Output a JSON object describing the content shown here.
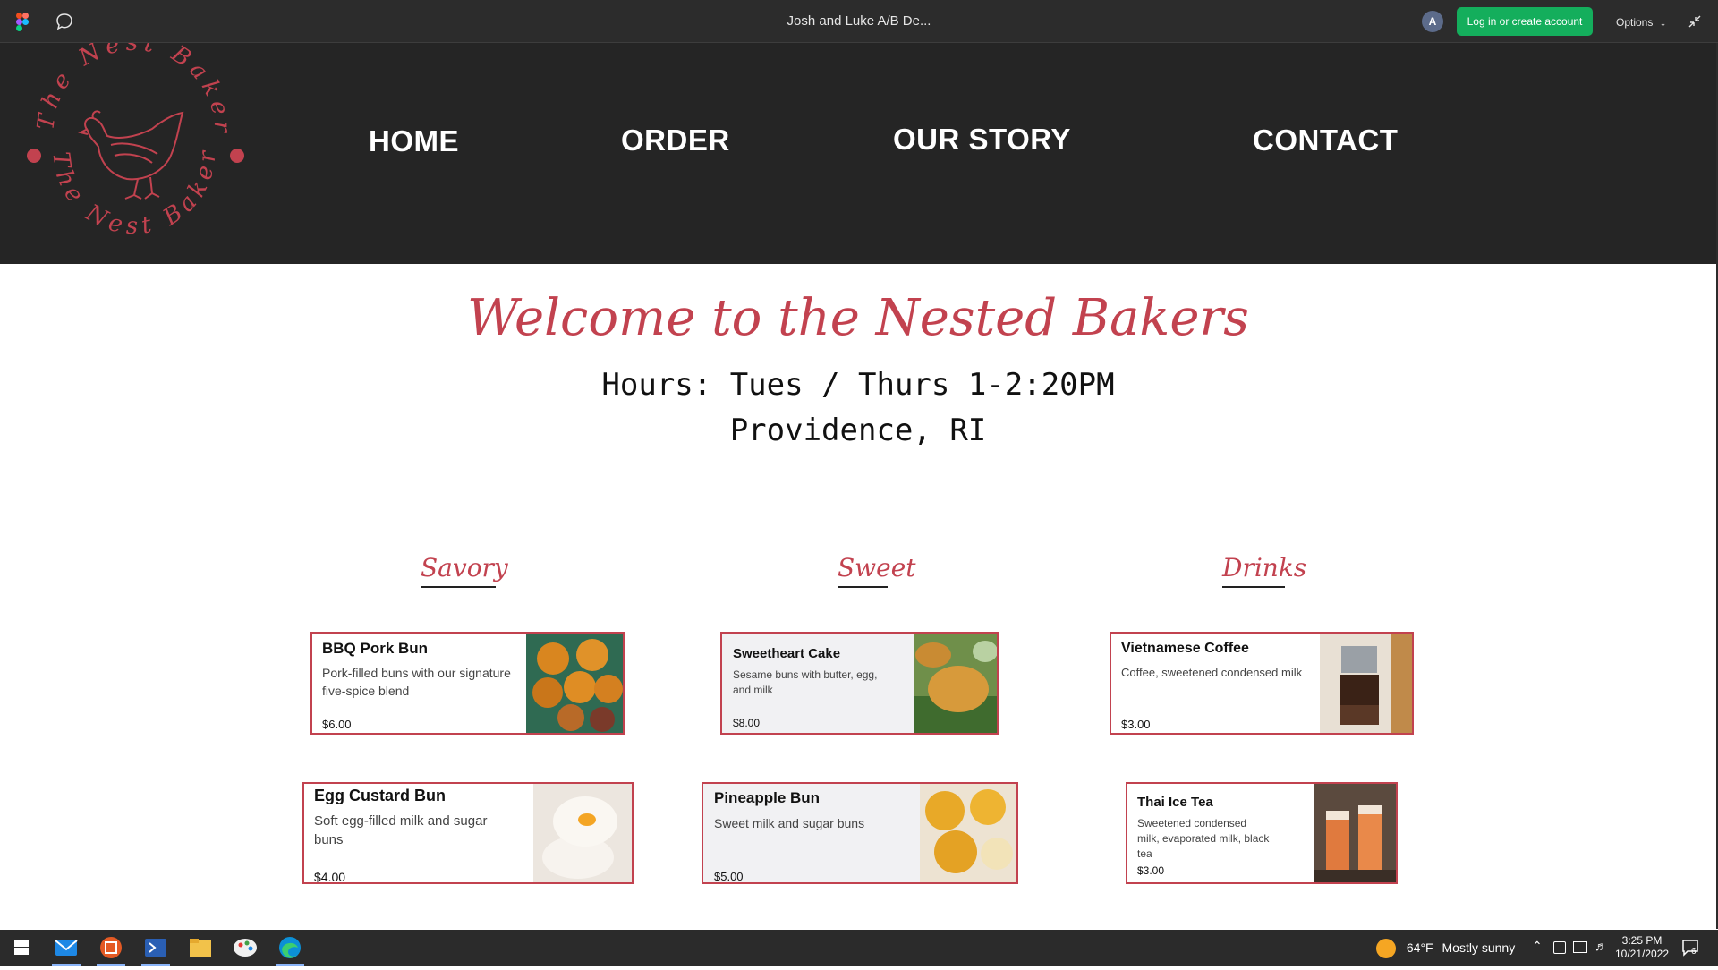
{
  "figma": {
    "file_title": "Josh and Luke A/B De...",
    "avatar_initial": "A",
    "login_label": "Log in or create account",
    "options_label": "Options"
  },
  "site": {
    "logo_text_top": "The Nest Bakery",
    "logo_text_bottom": "The Nest Bakery",
    "nav": [
      {
        "label": "HOME"
      },
      {
        "label": "ORDER"
      },
      {
        "label": "OUR STORY"
      },
      {
        "label": "CONTACT"
      }
    ],
    "welcome": "Welcome to the Nested Bakers",
    "hours": "Hours: Tues / Thurs 1-2:20PM",
    "location": "Providence, RI",
    "categories": [
      {
        "title": "Savory",
        "items": [
          {
            "name": "BBQ Pork Bun",
            "desc": "Pork-filled buns with our signature five-spice blend",
            "price": "$6.00"
          },
          {
            "name": "Egg Custard Bun",
            "desc": "Soft egg-filled milk and sugar buns",
            "price": "$4.00"
          }
        ]
      },
      {
        "title": "Sweet",
        "items": [
          {
            "name": "Sweetheart Cake",
            "desc": "Sesame buns with butter, egg, and milk",
            "price": "$8.00"
          },
          {
            "name": "Pineapple Bun",
            "desc": "Sweet milk and sugar buns",
            "price": "$5.00"
          }
        ]
      },
      {
        "title": "Drinks",
        "items": [
          {
            "name": "Vietnamese Coffee",
            "desc": "Coffee, sweetened condensed milk",
            "price": "$3.00"
          },
          {
            "name": "Thai Ice Tea",
            "desc": "Sweetened condensed milk, evaporated milk, black tea",
            "price": "$3.00"
          }
        ]
      }
    ],
    "accent_color": "#c2424f"
  },
  "taskbar": {
    "apps": [
      "windows-start",
      "mail",
      "office",
      "powershell",
      "file-explorer",
      "paint",
      "edge"
    ],
    "weather_temp": "64°F",
    "weather_text": "Mostly sunny",
    "time": "3:25 PM",
    "date": "10/21/2022",
    "notification_count": "6"
  }
}
